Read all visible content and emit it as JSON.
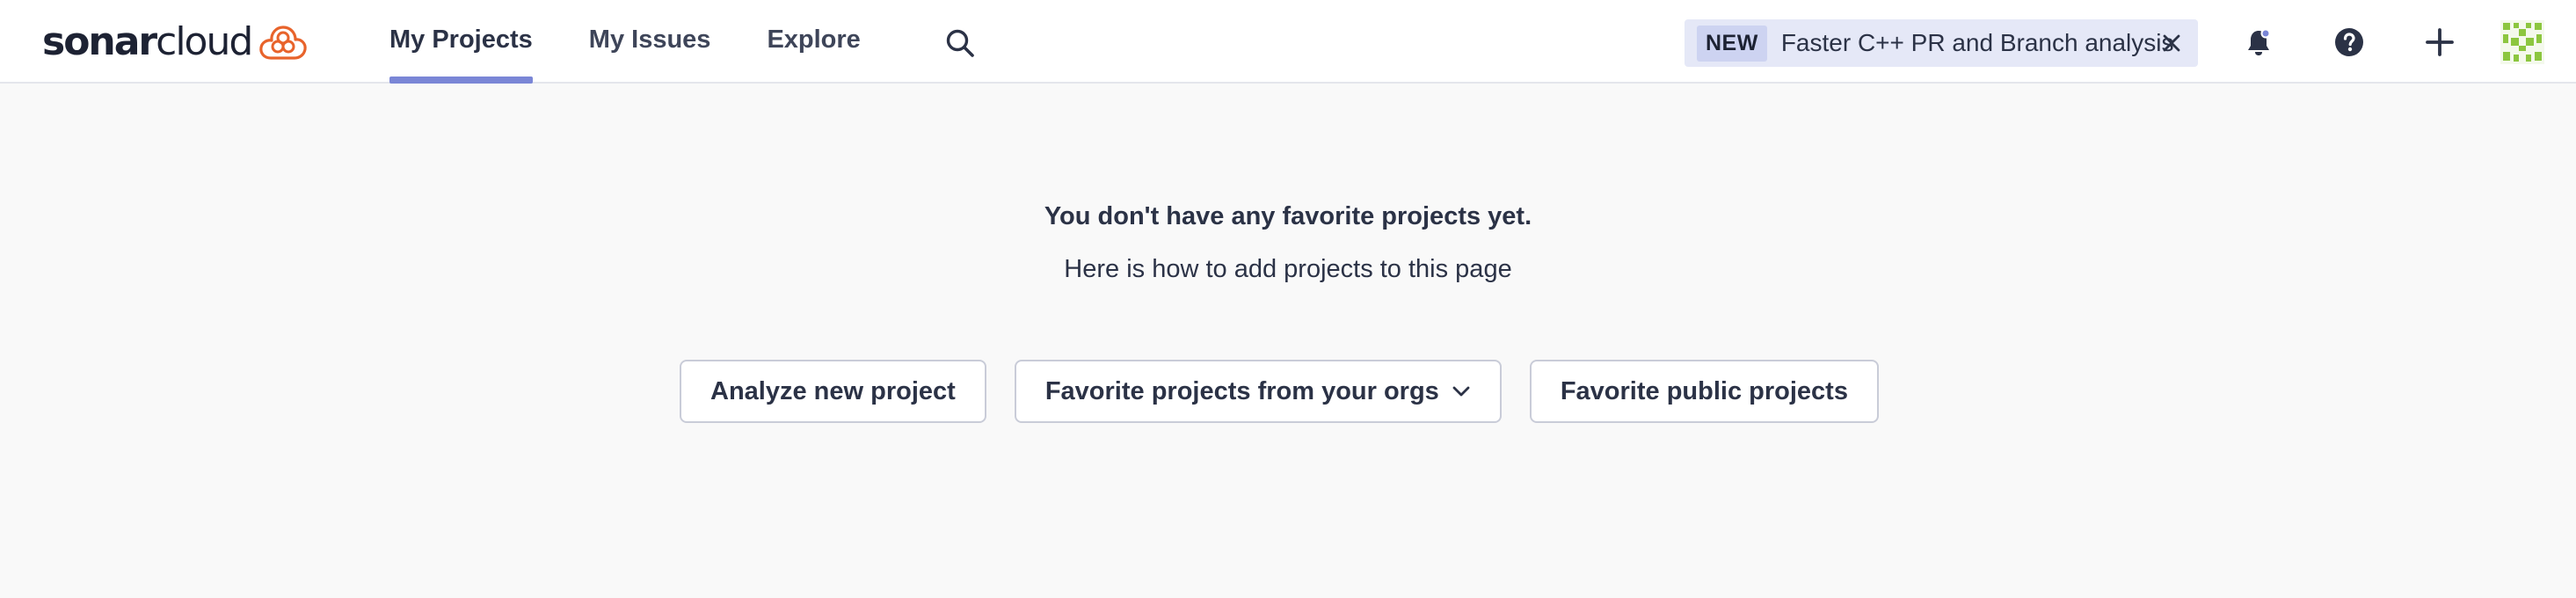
{
  "brand": {
    "name_bold": "sonar",
    "name_light": "cloud",
    "accent": "#e8632b"
  },
  "nav": {
    "items": [
      {
        "label": "My Projects",
        "active": true
      },
      {
        "label": "My Issues",
        "active": false
      },
      {
        "label": "Explore",
        "active": false
      }
    ]
  },
  "search": {
    "icon": "search-icon"
  },
  "promo": {
    "badge": "NEW",
    "text": "Faster C++ PR and Branch analysis",
    "close_icon": "close-icon"
  },
  "header_icons": {
    "notifications": "bell-icon",
    "help": "help-icon",
    "create": "plus-icon"
  },
  "main": {
    "title": "You don't have any favorite projects yet.",
    "subtitle": "Here is how to add projects to this page",
    "actions": [
      {
        "label": "Analyze new project"
      },
      {
        "label": "Favorite projects from your orgs",
        "dropdown": true
      },
      {
        "label": "Favorite public projects"
      }
    ]
  },
  "colors": {
    "nav_active_underline": "#7a86d6",
    "promo_bg": "#e5e8f7",
    "avatar_green": "#8cc63f"
  }
}
